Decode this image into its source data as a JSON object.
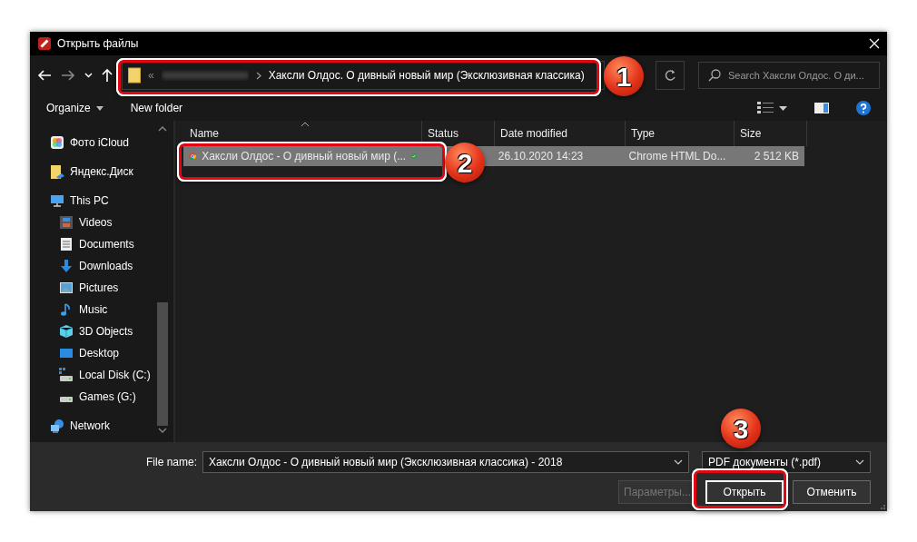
{
  "window": {
    "title": "Открыть файлы"
  },
  "address_bar": {
    "overflow": "«",
    "current_folder": "Хаксли Олдос. О дивный новый мир (Эксклюзивная классика)"
  },
  "search": {
    "placeholder": "Search Хаксли Олдос. О ди..."
  },
  "toolbar": {
    "organize": "Organize",
    "new_folder": "New folder"
  },
  "sidebar": {
    "items": [
      {
        "label": "Фото iCloud"
      },
      {
        "label": "Яндекс.Диск"
      },
      {
        "label": "This PC",
        "children": [
          {
            "label": "Videos"
          },
          {
            "label": "Documents"
          },
          {
            "label": "Downloads"
          },
          {
            "label": "Pictures"
          },
          {
            "label": "Music"
          },
          {
            "label": "3D Objects"
          },
          {
            "label": "Desktop"
          },
          {
            "label": "Local Disk (C:)"
          },
          {
            "label": "Games (G:)"
          }
        ]
      },
      {
        "label": "Network"
      }
    ]
  },
  "table": {
    "columns": [
      "Name",
      "Status",
      "Date modified",
      "Type",
      "Size"
    ],
    "rows": [
      {
        "name": "Хаксли Олдос - О дивный новый мир (...",
        "synced": true,
        "date": "26.10.2020 14:23",
        "type": "Chrome HTML Do...",
        "size": "2 512 KB",
        "selected": true
      }
    ]
  },
  "footer": {
    "file_name_label": "File name:",
    "file_name": "Хаксли Олдос - О дивный новый мир (Эксклюзивная классика) - 2018",
    "file_type": "PDF документы (*.pdf)",
    "buttons": [
      {
        "label": "Параметры...",
        "disabled": true
      },
      {
        "label": "Открыть",
        "disabled": false
      },
      {
        "label": "Отменить",
        "disabled": false
      }
    ]
  },
  "callouts": [
    "1",
    "2",
    "3"
  ]
}
